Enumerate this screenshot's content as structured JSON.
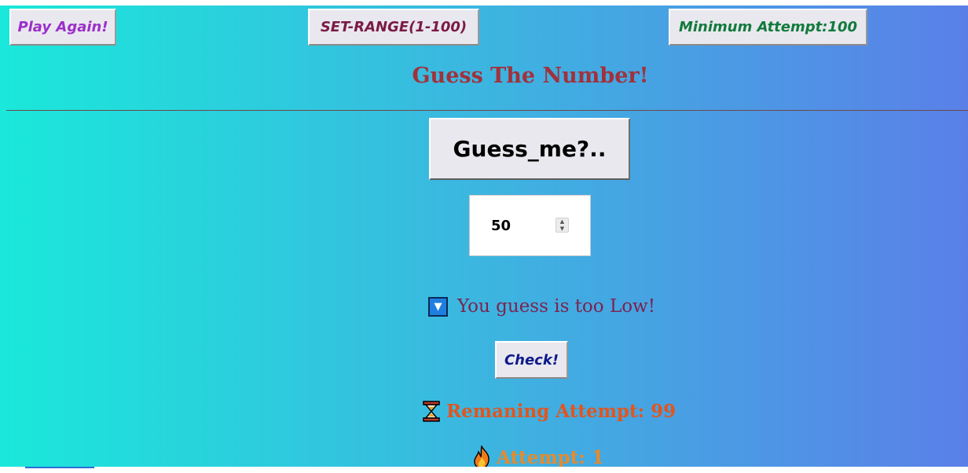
{
  "toolbar": {
    "play_again_label": "Play Again!",
    "set_range_label": "SET-RANGE(1-100)",
    "minimum_attempt_label": "Minimum Attempt:100"
  },
  "title": "Guess The Number!",
  "guess_button_label": "Guess_me?..",
  "guess_input": {
    "value": "50"
  },
  "feedback": {
    "icon": "down-arrow-button-icon",
    "text": "You guess is too Low!"
  },
  "check_button_label": "Check!",
  "remaining": {
    "icon": "hourglass-icon",
    "text": "Remaning Attempt: 99"
  },
  "attempt": {
    "icon": "fire-icon",
    "text": "Attempt: 1"
  },
  "colors": {
    "gradient_start": "#1ae8da",
    "gradient_end": "#5a80e8",
    "title": "#a0323c",
    "feedback_text": "#7a2450",
    "remaining_text": "#e0561f",
    "attempt_text": "#e88a2a",
    "play_again": "#9b2fc9",
    "set_range": "#7a1b45",
    "minimum_attempt": "#127a3c",
    "check": "#0f1a8a"
  }
}
